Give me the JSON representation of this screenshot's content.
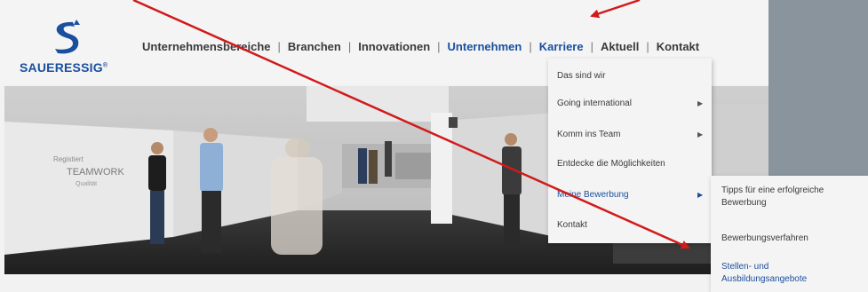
{
  "brand": {
    "name": "SAUERESSIG",
    "trademark": "®",
    "color": "#1a4f9e"
  },
  "nav": {
    "items": [
      {
        "label": "Unternehmensbereiche",
        "state": "normal"
      },
      {
        "label": "Branchen",
        "state": "normal"
      },
      {
        "label": "Innovationen",
        "state": "normal"
      },
      {
        "label": "Unternehmen",
        "state": "active"
      },
      {
        "label": "Karriere",
        "state": "open"
      },
      {
        "label": "Aktuell",
        "state": "normal"
      },
      {
        "label": "Kontakt",
        "state": "normal"
      }
    ],
    "separator": "|"
  },
  "dropdown": {
    "items": [
      {
        "label": "Das sind wir",
        "has_submenu": false
      },
      {
        "label": "Going international",
        "has_submenu": true
      },
      {
        "label": "Komm ins Team",
        "has_submenu": true
      },
      {
        "label": "Entdecke die Möglichkeiten",
        "has_submenu": false
      },
      {
        "label": "Meine Bewerbung",
        "has_submenu": true,
        "state": "active"
      },
      {
        "label": "Kontakt",
        "has_submenu": false
      }
    ],
    "submenu_icon": "▶"
  },
  "submenu": {
    "items": [
      {
        "label": "Tipps für eine erfolgreiche Bewerbung"
      },
      {
        "label": "Bewerbungsverfahren"
      },
      {
        "label": "Stellen- und Ausbildungsangebote",
        "state": "active"
      }
    ]
  },
  "hero": {
    "wall_words": [
      "Registiert",
      "TEAMWORK",
      "Qualität"
    ]
  },
  "colors": {
    "accent": "#1a4f9e",
    "annotation_arrow": "#d11a1a",
    "side_band": "#8a949c"
  }
}
